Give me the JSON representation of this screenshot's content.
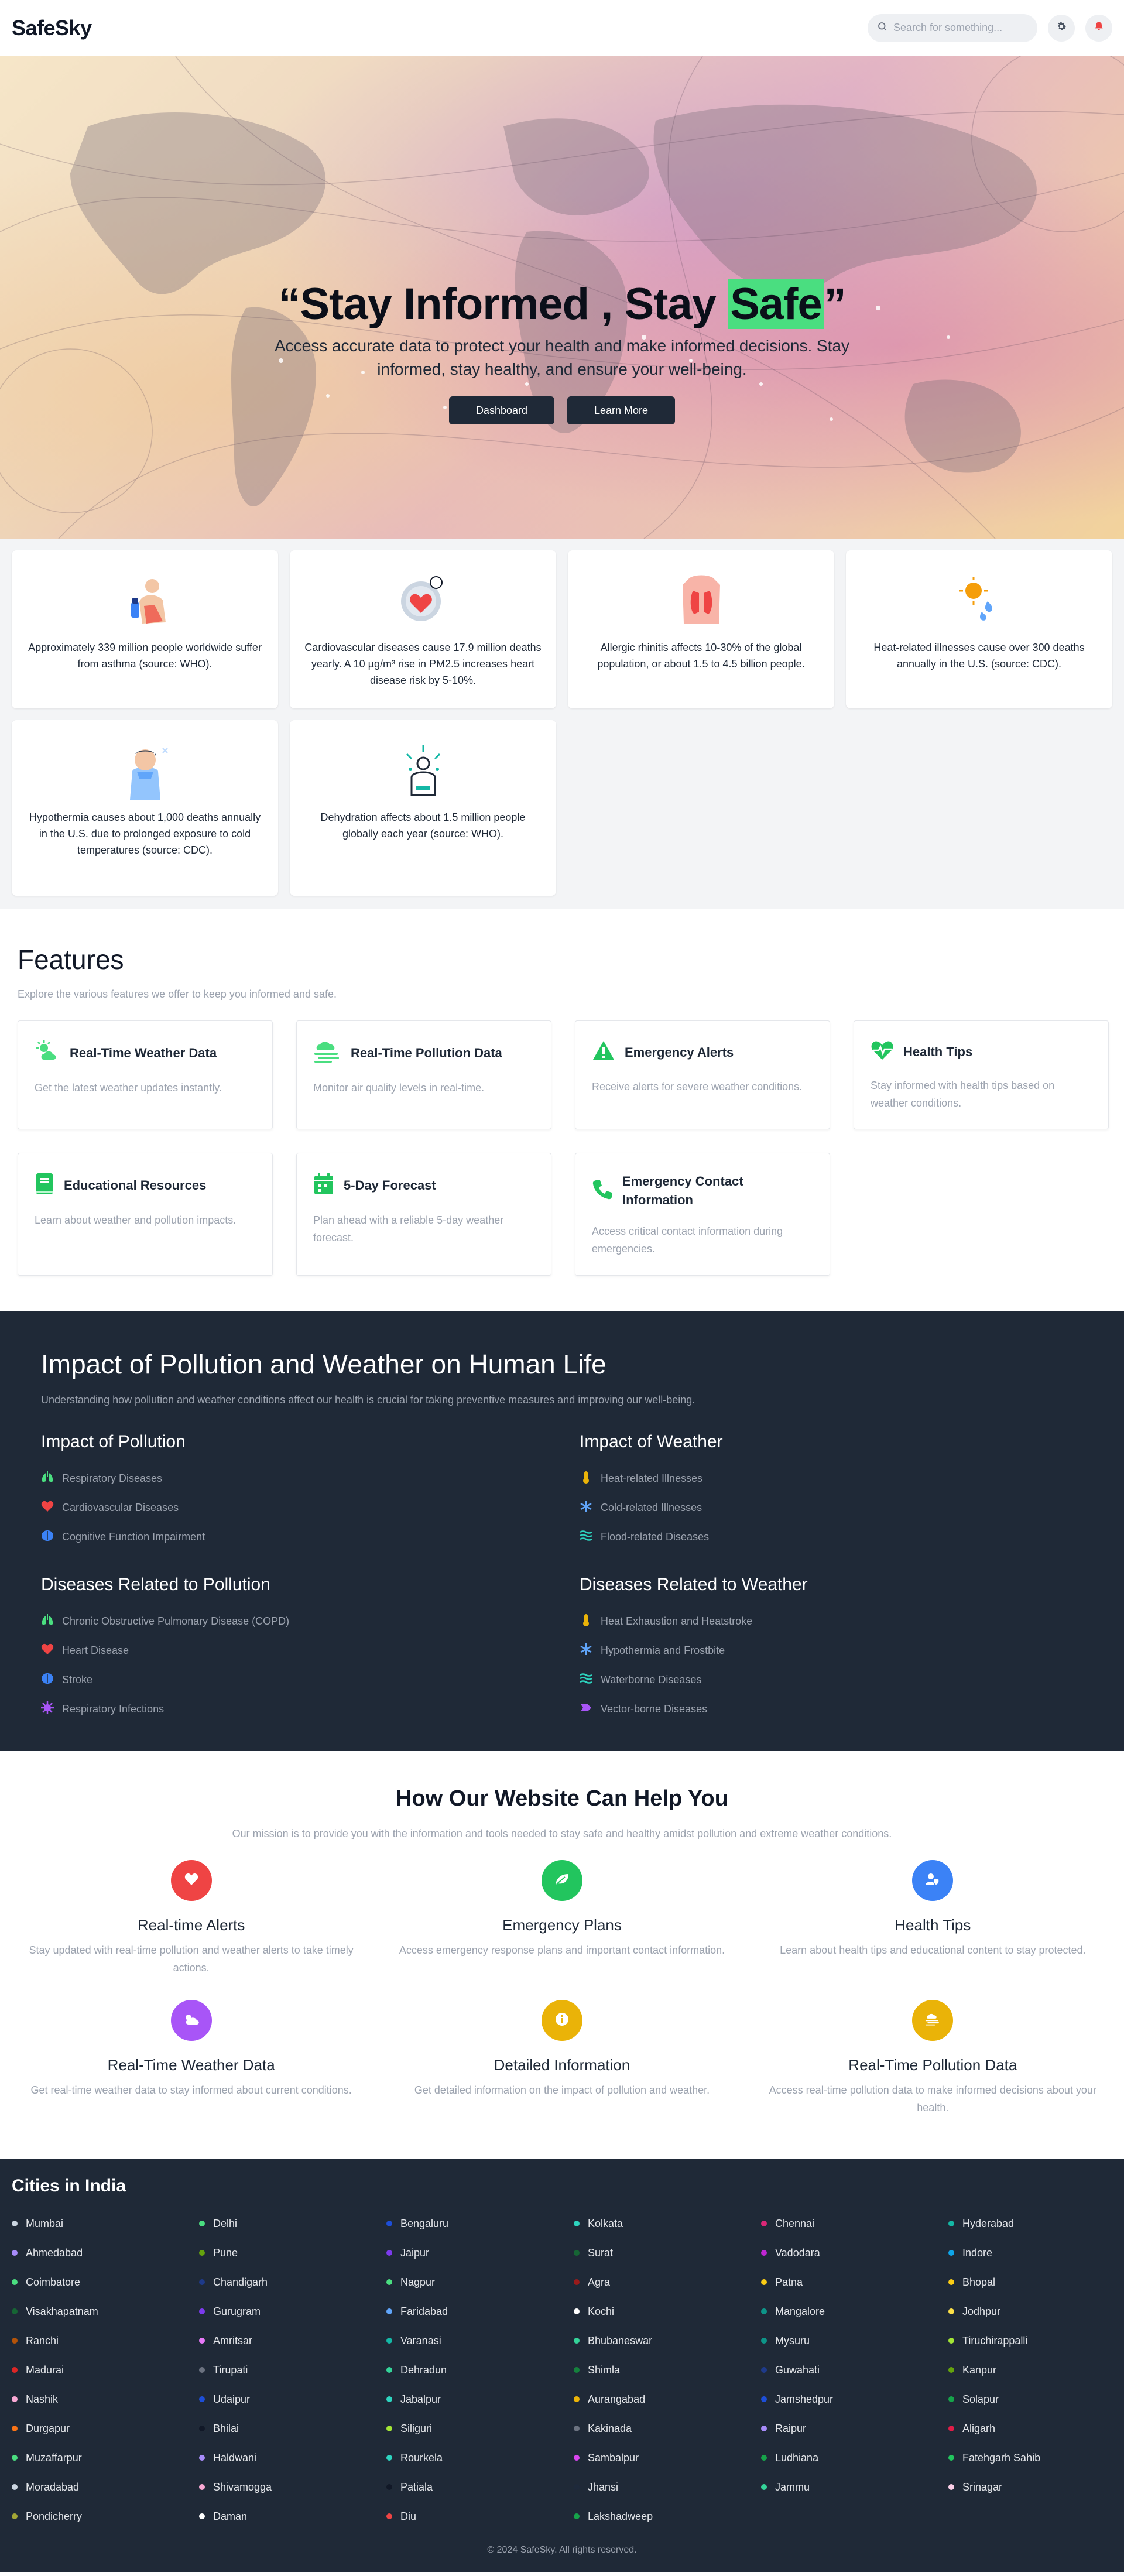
{
  "header": {
    "brand": "SafeSky",
    "search_placeholder": "Search for something...",
    "settings_icon": "gear-icon",
    "notification_icon": "bell-icon"
  },
  "hero": {
    "title_open": "“Stay Informed , Stay ",
    "title_highlight": "Safe",
    "title_close": "”",
    "subtitle": "Access accurate data to protect your health and make informed decisions. Stay informed, stay healthy, and ensure your well-being.",
    "dashboard_label": "Dashboard",
    "learn_more_label": "Learn More"
  },
  "facts": [
    {
      "icon": "asthma-inhaler-icon",
      "text": "Approximately 339 million people worldwide suffer from asthma (source: WHO)."
    },
    {
      "icon": "heart-icon",
      "text": "Cardiovascular diseases cause 17.9 million deaths yearly. A 10 µg/m³ rise in PM2.5 increases heart disease risk by 5-10%."
    },
    {
      "icon": "lungs-body-icon",
      "text": "Allergic rhinitis affects 10-30% of the global population, or about 1.5 to 4.5 billion people."
    },
    {
      "icon": "heat-sun-icon",
      "text": "Heat-related illnesses cause over 300 deaths annually in the U.S. (source: CDC)."
    },
    {
      "icon": "cold-person-icon",
      "text": "Hypothermia causes about 1,000 deaths annually in the U.S. due to prolonged exposure to cold temperatures (source: CDC)."
    },
    {
      "icon": "dehydration-icon",
      "text": "Dehydration affects about 1.5 million people globally each year (source: WHO)."
    }
  ],
  "features": {
    "title": "Features",
    "subtitle": "Explore the various features we offer to keep you informed and safe.",
    "items": [
      {
        "icon": "sun-cloud-icon",
        "title": "Real-Time Weather Data",
        "desc": "Get the latest weather updates instantly."
      },
      {
        "icon": "smog-icon",
        "title": "Real-Time Pollution Data",
        "desc": "Monitor air quality levels in real-time."
      },
      {
        "icon": "warning-icon",
        "title": "Emergency Alerts",
        "desc": "Receive alerts for severe weather conditions."
      },
      {
        "icon": "heartbeat-icon",
        "title": "Health Tips",
        "desc": "Stay informed with health tips based on weather conditions."
      },
      {
        "icon": "book-icon",
        "title": "Educational Resources",
        "desc": "Learn about weather and pollution impacts."
      },
      {
        "icon": "calendar-icon",
        "title": "5-Day Forecast",
        "desc": "Plan ahead with a reliable 5-day weather forecast."
      },
      {
        "icon": "phone-icon",
        "title": "Emergency Contact Information",
        "desc": "Access critical contact information during emergencies."
      }
    ]
  },
  "impact": {
    "title": "Impact of Pollution and Weather on Human Life",
    "subtitle": "Understanding how pollution and weather conditions affect our health is crucial for taking preventive measures and improving our well-being.",
    "pollution": {
      "heading": "Impact of Pollution",
      "items": [
        {
          "icon": "lungs-icon",
          "text": "Respiratory Diseases"
        },
        {
          "icon": "heart-icon",
          "text": "Cardiovascular Diseases"
        },
        {
          "icon": "brain-icon",
          "text": "Cognitive Function Impairment"
        }
      ]
    },
    "weather": {
      "heading": "Impact of Weather",
      "items": [
        {
          "icon": "thermometer-icon",
          "text": "Heat-related Illnesses"
        },
        {
          "icon": "snowflake-icon",
          "text": "Cold-related Illnesses"
        },
        {
          "icon": "water-icon",
          "text": "Flood-related Diseases"
        }
      ]
    },
    "pollution_diseases": {
      "heading": "Diseases Related to Pollution",
      "items": [
        {
          "icon": "lungs-icon",
          "text": "Chronic Obstructive Pulmonary Disease (COPD)"
        },
        {
          "icon": "heart-icon",
          "text": "Heart Disease"
        },
        {
          "icon": "brain-icon",
          "text": "Stroke"
        },
        {
          "icon": "virus-icon",
          "text": "Respiratory Infections"
        }
      ]
    },
    "weather_diseases": {
      "heading": "Diseases Related to Weather",
      "items": [
        {
          "icon": "thermometer-icon",
          "text": "Heat Exhaustion and Heatstroke"
        },
        {
          "icon": "snowflake-icon",
          "text": "Hypothermia and Frostbite"
        },
        {
          "icon": "water-icon",
          "text": "Waterborne Diseases"
        },
        {
          "icon": "mosquito-icon",
          "text": "Vector-borne Diseases"
        }
      ]
    }
  },
  "help": {
    "title": "How Our Website Can Help You",
    "subtitle": "Our mission is to provide you with the information and tools needed to stay safe and healthy amidst pollution and extreme weather conditions.",
    "items": [
      {
        "icon": "heart-icon",
        "color": "#ef4444",
        "title": "Real-time Alerts",
        "desc": "Stay updated with real-time pollution and weather alerts to take timely actions."
      },
      {
        "icon": "leaf-icon",
        "color": "#22c55e",
        "title": "Emergency Plans",
        "desc": "Access emergency response plans and important contact information."
      },
      {
        "icon": "user-shield-icon",
        "color": "#3b82f6",
        "title": "Health Tips",
        "desc": "Learn about health tips and educational content to stay protected."
      },
      {
        "icon": "cloud-sun-icon",
        "color": "#a855f7",
        "title": "Real-Time Weather Data",
        "desc": "Get real-time weather data to stay informed about current conditions."
      },
      {
        "icon": "info-icon",
        "color": "#eab308",
        "title": "Detailed Information",
        "desc": "Get detailed information on the impact of pollution and weather."
      },
      {
        "icon": "smog-icon",
        "color": "#eab308",
        "title": "Real-Time Pollution Data",
        "desc": "Access real-time pollution data to make informed decisions about your health."
      }
    ]
  },
  "cities": {
    "title": "Cities in India",
    "list": [
      {
        "name": "Mumbai",
        "color": "#cbd5e1"
      },
      {
        "name": "Delhi",
        "color": "#4ade80"
      },
      {
        "name": "Bengaluru",
        "color": "#1d4ed8"
      },
      {
        "name": "Kolkata",
        "color": "#2dd4bf"
      },
      {
        "name": "Chennai",
        "color": "#db2777"
      },
      {
        "name": "Hyderabad",
        "color": "#14b8a6"
      },
      {
        "name": "Ahmedabad",
        "color": "#a78bfa"
      },
      {
        "name": "Pune",
        "color": "#65a30d"
      },
      {
        "name": "Jaipur",
        "color": "#7c3aed"
      },
      {
        "name": "Surat",
        "color": "#166534"
      },
      {
        "name": "Vadodara",
        "color": "#c026d3"
      },
      {
        "name": "Indore",
        "color": "#0ea5e9"
      },
      {
        "name": "Coimbatore",
        "color": "#4ade80"
      },
      {
        "name": "Chandigarh",
        "color": "#1e3a8a"
      },
      {
        "name": "Nagpur",
        "color": "#4ade80"
      },
      {
        "name": "Agra",
        "color": "#991b1b"
      },
      {
        "name": "Patna",
        "color": "#facc15"
      },
      {
        "name": "Bhopal",
        "color": "#facc15"
      },
      {
        "name": "Visakhapatnam",
        "color": "#166534"
      },
      {
        "name": "Gurugram",
        "color": "#7c3aed"
      },
      {
        "name": "Faridabad",
        "color": "#60a5fa"
      },
      {
        "name": "Kochi",
        "color": "#ffffff"
      },
      {
        "name": "Mangalore",
        "color": "#0d9488"
      },
      {
        "name": "Jodhpur",
        "color": "#fde047"
      },
      {
        "name": "Ranchi",
        "color": "#b45309"
      },
      {
        "name": "Amritsar",
        "color": "#e879f9"
      },
      {
        "name": "Varanasi",
        "color": "#14b8a6"
      },
      {
        "name": "Bhubaneswar",
        "color": "#34d399"
      },
      {
        "name": "Mysuru",
        "color": "#0d9488"
      },
      {
        "name": "Tiruchirappalli",
        "color": "#a3e635"
      },
      {
        "name": "Madurai",
        "color": "#dc2626"
      },
      {
        "name": "Tirupati",
        "color": "#6b7280"
      },
      {
        "name": "Dehradun",
        "color": "#34d399"
      },
      {
        "name": "Shimla",
        "color": "#15803d"
      },
      {
        "name": "Guwahati",
        "color": "#1e3a8a"
      },
      {
        "name": "Kanpur",
        "color": "#65a30d"
      },
      {
        "name": "Nashik",
        "color": "#f9a8d4"
      },
      {
        "name": "Udaipur",
        "color": "#1d4ed8"
      },
      {
        "name": "Jabalpur",
        "color": "#2dd4bf"
      },
      {
        "name": "Aurangabad",
        "color": "#eab308"
      },
      {
        "name": "Jamshedpur",
        "color": "#1d4ed8"
      },
      {
        "name": "Solapur",
        "color": "#16a34a"
      },
      {
        "name": "Durgapur",
        "color": "#f97316"
      },
      {
        "name": "Bhilai",
        "color": "#111827"
      },
      {
        "name": "Siliguri",
        "color": "#a3e635"
      },
      {
        "name": "Kakinada",
        "color": "#6b7280"
      },
      {
        "name": "Raipur",
        "color": "#a78bfa"
      },
      {
        "name": "Aligarh",
        "color": "#e11d48"
      },
      {
        "name": "Muzaffarpur",
        "color": "#4ade80"
      },
      {
        "name": "Haldwani",
        "color": "#a78bfa"
      },
      {
        "name": "Rourkela",
        "color": "#2dd4bf"
      },
      {
        "name": "Sambalpur",
        "color": "#d946ef"
      },
      {
        "name": "Ludhiana",
        "color": "#16a34a"
      },
      {
        "name": "Fatehgarh Sahib",
        "color": "#22c55e"
      },
      {
        "name": "Moradabad",
        "color": "#cbd5e1"
      },
      {
        "name": "Shivamogga",
        "color": "#f9a8d4"
      },
      {
        "name": "Patiala",
        "color": "#111827"
      },
      {
        "name": "Jhansi",
        "color": "#1e293b"
      },
      {
        "name": "Jammu",
        "color": "#34d399"
      },
      {
        "name": "Srinagar",
        "color": "#fbcfe8"
      },
      {
        "name": "Pondicherry",
        "color": "#a3a635"
      },
      {
        "name": "Daman",
        "color": "#ffffff"
      },
      {
        "name": "Diu",
        "color": "#ef4444"
      },
      {
        "name": "Lakshadweep",
        "color": "#16a34a"
      }
    ]
  },
  "footer": {
    "copyright": "© 2024 SafeSky. All rights reserved."
  }
}
